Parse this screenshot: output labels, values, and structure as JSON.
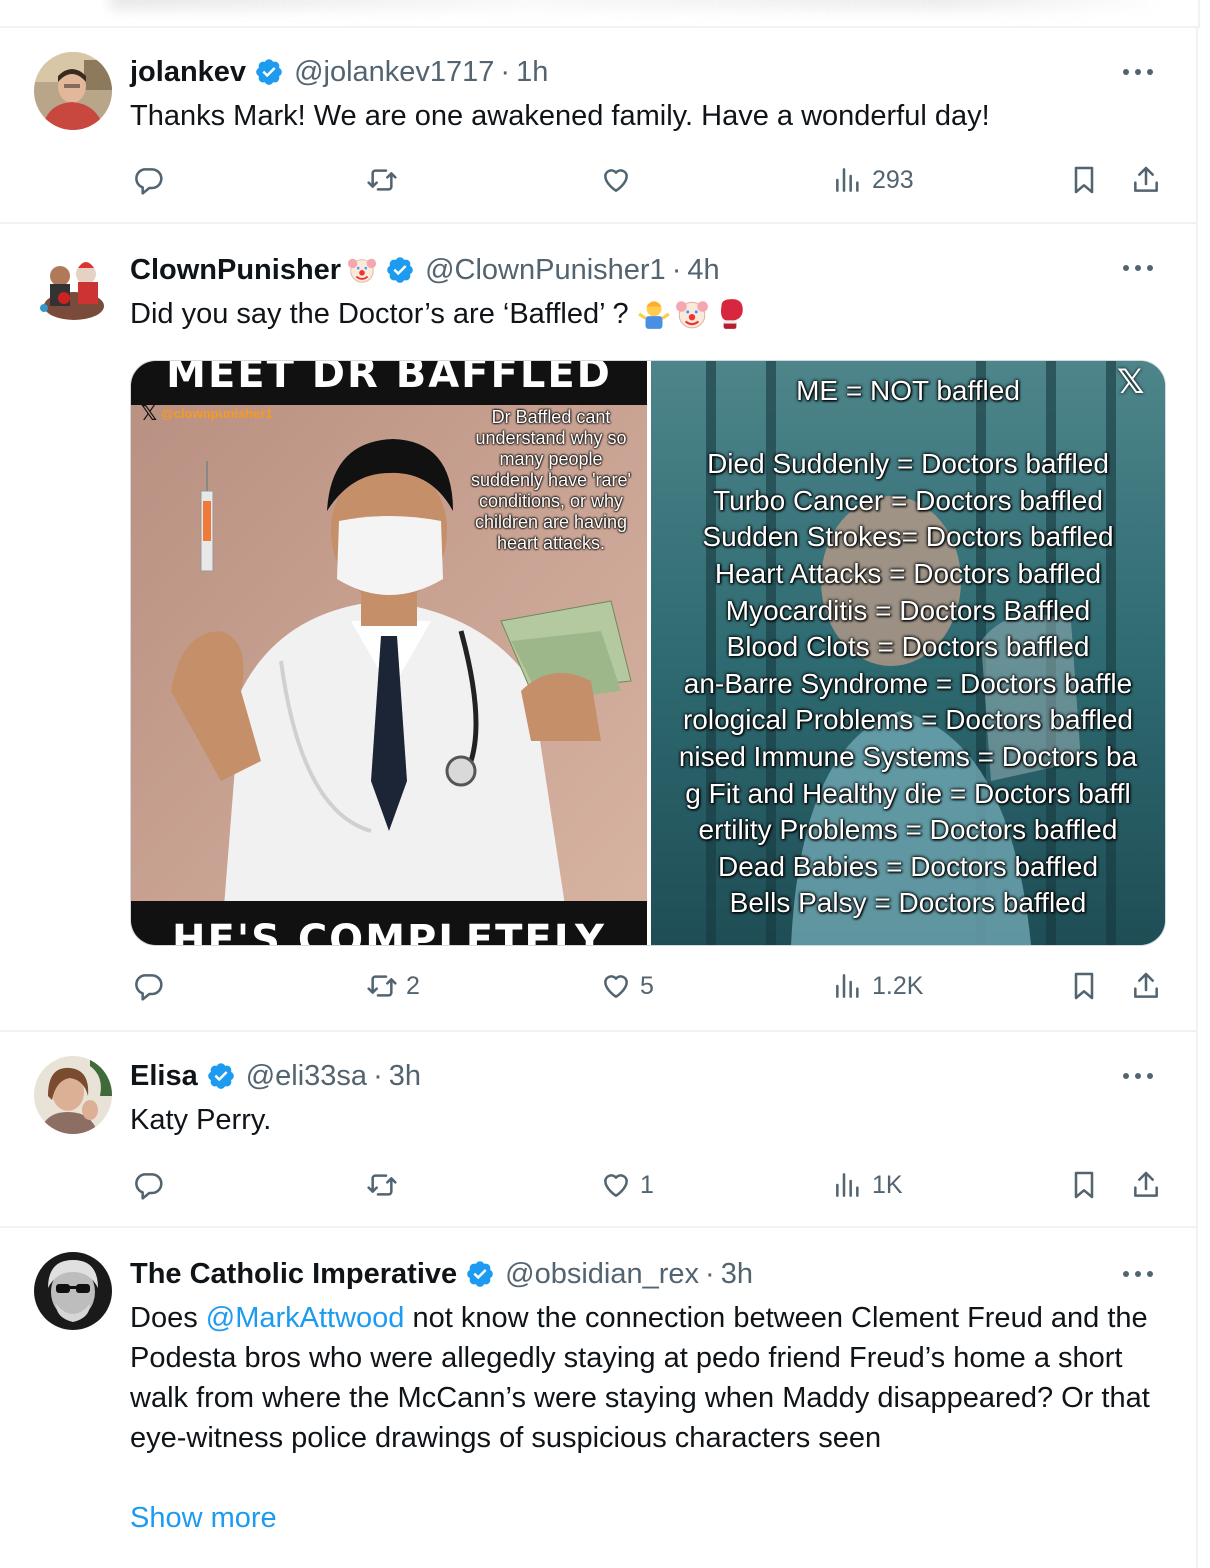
{
  "tweets": [
    {
      "name": "jolankev",
      "handle": "@jolankev1717",
      "time": "1h",
      "text": "Thanks Mark! We are one awakened family. Have a wonderful day!",
      "replies": "",
      "reposts": "",
      "likes": "",
      "views": "293"
    },
    {
      "name": "ClownPunisher",
      "handle": "@ClownPunisher1",
      "time": "4h",
      "text": "Did you say the Doctor’s are ‘Baffled’ ?",
      "replies": "",
      "reposts": "2",
      "likes": "5",
      "views": "1.2K",
      "media": {
        "left": {
          "top_banner": "MEET DR BAFFLED",
          "watermark": "@clownpunisher1",
          "caption": "Dr Baffled cant understand why so many people suddenly have 'rare' conditions, or why children are having heart attacks.",
          "bottom_banner": "HE'S COMPLETELY BAFFLED"
        },
        "right": {
          "lines": [
            "ME = NOT baffled",
            "",
            "Died Suddenly = Doctors baffled",
            "Turbo Cancer = Doctors baffled",
            "Sudden Strokes= Doctors baffled",
            "Heart Attacks = Doctors baffled",
            "Myocarditis = Doctors Baffled",
            "Blood Clots = Doctors baffled",
            "an-Barre Syndrome = Doctors baffle",
            "rological Problems = Doctors baffled",
            "nised Immune Systems = Doctors ba",
            "g Fit and Healthy die = Doctors baffl",
            "ertility Problems = Doctors baffled",
            "Dead Babies = Doctors baffled",
            "Bells Palsy = Doctors baffled"
          ]
        }
      }
    },
    {
      "name": "Elisa",
      "handle": "@eli33sa",
      "time": "3h",
      "text": "Katy Perry.",
      "replies": "",
      "reposts": "",
      "likes": "1",
      "views": "1K"
    },
    {
      "name": "The Catholic Imperative",
      "handle": "@obsidian_rex",
      "time": "3h",
      "text_before": "Does ",
      "mention": "@MarkAttwood",
      "text_after": " not know the connection between Clement Freud and the Podesta bros who were allegedly staying at pedo friend Freud’s home a short walk from where the McCann’s were staying when Maddy disappeared? Or that eye-witness police drawings of suspicious characters seen",
      "show_more": "Show more"
    }
  ],
  "separator": "·",
  "colors": {
    "text": "#0f1419",
    "muted": "#536471",
    "accent": "#1d9bf0",
    "border": "#eff3f4"
  }
}
